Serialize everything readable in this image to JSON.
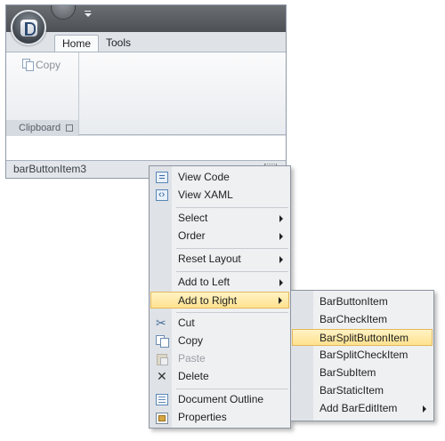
{
  "ribbon": {
    "tabs": [
      {
        "label": "Home"
      },
      {
        "label": "Tools"
      }
    ],
    "groups": [
      {
        "caption": "Clipboard",
        "buttons": [
          {
            "label": "Copy",
            "icon": "copy-icon",
            "enabled": false
          }
        ]
      }
    ]
  },
  "statusbar": {
    "item_label": "barButtonItem3"
  },
  "context_menu": {
    "items": [
      {
        "label": "View Code",
        "icon": "view-code-icon"
      },
      {
        "label": "View XAML",
        "icon": "view-xaml-icon"
      },
      {
        "label": "Select",
        "submenu": true
      },
      {
        "label": "Order",
        "submenu": true
      },
      {
        "label": "Reset Layout",
        "submenu": true
      },
      {
        "label": "Add to Left",
        "submenu": true
      },
      {
        "label": "Add to Right",
        "submenu": true,
        "highlighted": true
      },
      {
        "label": "Cut",
        "icon": "cut-icon"
      },
      {
        "label": "Copy",
        "icon": "copy-icon"
      },
      {
        "label": "Paste",
        "icon": "paste-icon",
        "enabled": false
      },
      {
        "label": "Delete",
        "icon": "delete-icon"
      },
      {
        "label": "Document Outline",
        "icon": "document-outline-icon"
      },
      {
        "label": "Properties",
        "icon": "properties-icon"
      }
    ]
  },
  "submenu": {
    "items": [
      {
        "label": "BarButtonItem"
      },
      {
        "label": "BarCheckItem"
      },
      {
        "label": "BarSplitButtonItem",
        "highlighted": true
      },
      {
        "label": "BarSplitCheckItem"
      },
      {
        "label": "BarSubItem"
      },
      {
        "label": "BarStaticItem"
      },
      {
        "label": "Add BarEditItem",
        "submenu": true
      }
    ]
  },
  "colors": {
    "highlight_top": "#fff3c4",
    "highlight_bottom": "#ffe28f",
    "menu_background": "#eef0f2",
    "menu_gutter": "#dfe3e8"
  }
}
